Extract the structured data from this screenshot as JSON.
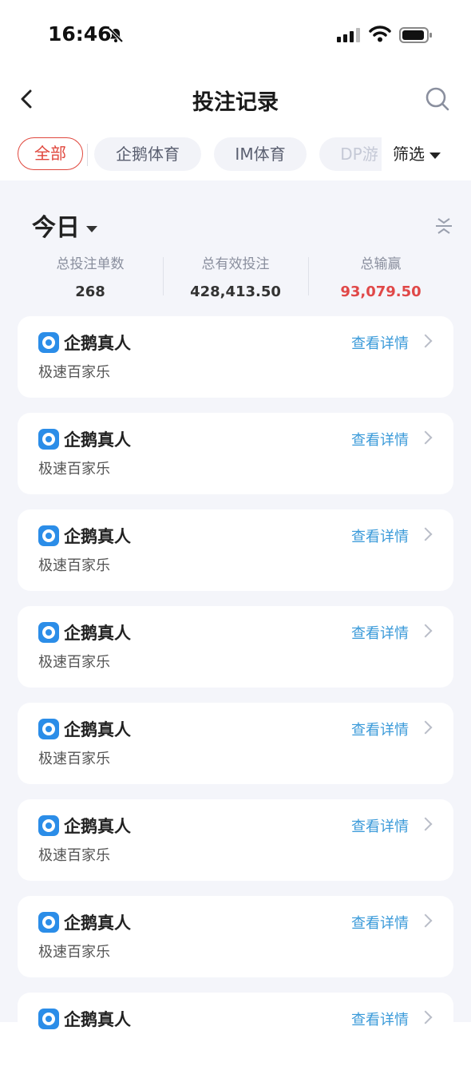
{
  "status_bar": {
    "time": "16:46"
  },
  "header": {
    "title": "投注记录"
  },
  "tabs": [
    {
      "label": "全部",
      "active": true
    },
    {
      "label": "企鹅体育"
    },
    {
      "label": "IM体育"
    },
    {
      "label": "DP游"
    }
  ],
  "filter": {
    "label": "筛选"
  },
  "period": {
    "label": "今日"
  },
  "stats": [
    {
      "label": "总投注单数",
      "value": "268"
    },
    {
      "label": "总有效投注",
      "value": "428,413.50"
    },
    {
      "label": "总输赢",
      "value": "93,079.50"
    }
  ],
  "records": [
    {
      "provider": "企鹅真人",
      "game": "极速百家乐",
      "action": "查看详情"
    },
    {
      "provider": "企鹅真人",
      "game": "极速百家乐",
      "action": "查看详情"
    },
    {
      "provider": "企鹅真人",
      "game": "极速百家乐",
      "action": "查看详情"
    },
    {
      "provider": "企鹅真人",
      "game": "极速百家乐",
      "action": "查看详情"
    },
    {
      "provider": "企鹅真人",
      "game": "极速百家乐",
      "action": "查看详情"
    },
    {
      "provider": "企鹅真人",
      "game": "极速百家乐",
      "action": "查看详情"
    },
    {
      "provider": "企鹅真人",
      "game": "极速百家乐",
      "action": "查看详情"
    },
    {
      "provider": "企鹅真人",
      "game": "",
      "action": "查看详情"
    }
  ],
  "colors": {
    "accent_red": "#e0473d",
    "link_blue": "#3a9ad9",
    "win_red": "#e04848"
  },
  "icons": [
    "bell-muted-icon",
    "cellular-signal-icon",
    "wifi-icon",
    "battery-icon",
    "back-arrow-icon",
    "search-icon",
    "caret-down-icon",
    "collapse-icon",
    "provider-logo-icon",
    "chevron-right-icon"
  ]
}
